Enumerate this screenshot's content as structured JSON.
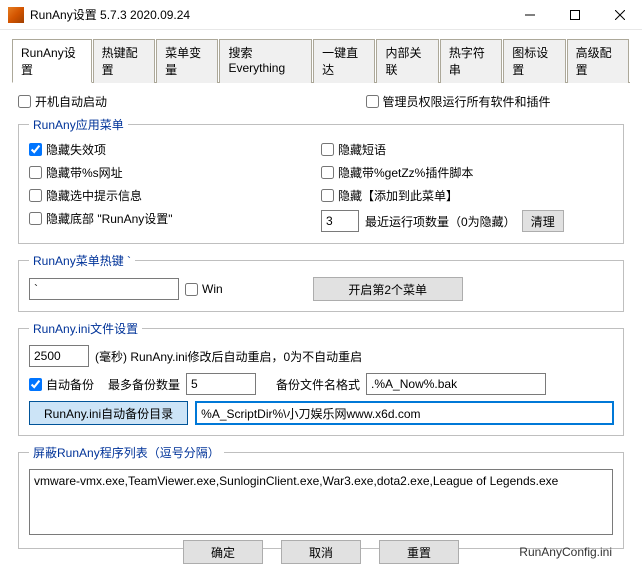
{
  "window": {
    "title": "RunAny设置 5.7.3 2020.09.24"
  },
  "tabs": [
    "RunAny设置",
    "热键配置",
    "菜单变量",
    "搜索Everything",
    "一键直达",
    "内部关联",
    "热字符串",
    "图标设置",
    "高级配置"
  ],
  "topRow": {
    "autoStart": "开机自动启动",
    "adminRun": "管理员权限运行所有软件和插件"
  },
  "appMenu": {
    "legend": "RunAny应用菜单",
    "left": {
      "hideInvalid": "隐藏失效项",
      "hideSUrl": "隐藏带%s网址",
      "hideSelPrompt": "隐藏选中提示信息",
      "hideBottom": "隐藏底部 \"RunAny设置\""
    },
    "right": {
      "hideShort": "隐藏短语",
      "hideGetZz": "隐藏带%getZz%插件脚本",
      "hideAddTo": "隐藏【添加到此菜单】",
      "recentCount": "3",
      "recentLabel": "最近运行项数量（0为隐藏）",
      "cleanBtn": "清理"
    }
  },
  "hotkey": {
    "legend": "RunAny菜单热键 `",
    "value": "`",
    "win": "Win",
    "openSecond": "开启第2个菜单"
  },
  "iniSettings": {
    "legend": "RunAny.ini文件设置",
    "delay": "2500",
    "delayLabel": "(毫秒)  RunAny.ini修改后自动重启，0为不自动重启",
    "autoBackup": "自动备份",
    "maxBackupLabel": "最多备份数量",
    "maxBackup": "5",
    "backupFormatLabel": "备份文件名格式",
    "backupFormat": ".%A_Now%.bak",
    "backupDirBtn": "RunAny.ini自动备份目录",
    "backupDir": "%A_ScriptDir%\\小刀娱乐网www.x6d.com"
  },
  "blocklist": {
    "legend": "屏蔽RunAny程序列表（逗号分隔）",
    "value": "vmware-vmx.exe,TeamViewer.exe,SunloginClient.exe,War3.exe,dota2.exe,League of Legends.exe"
  },
  "footer": {
    "ok": "确定",
    "cancel": "取消",
    "reset": "重置",
    "config": "RunAnyConfig.ini"
  }
}
